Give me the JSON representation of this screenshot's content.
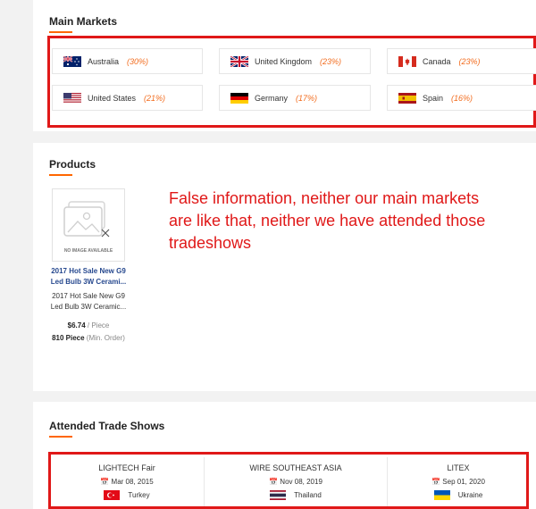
{
  "main_markets": {
    "title": "Main Markets",
    "items": [
      {
        "country": "Australia",
        "pct": "(30%)",
        "flag": "australia-flag"
      },
      {
        "country": "United Kingdom",
        "pct": "(23%)",
        "flag": "uk-flag"
      },
      {
        "country": "Canada",
        "pct": "(23%)",
        "flag": "canada-flag"
      },
      {
        "country": "United States",
        "pct": "(21%)",
        "flag": "usa-flag"
      },
      {
        "country": "Germany",
        "pct": "(17%)",
        "flag": "germany-flag"
      },
      {
        "country": "Spain",
        "pct": "(16%)",
        "flag": "spain-flag"
      }
    ]
  },
  "products": {
    "title": "Products",
    "item": {
      "image_placeholder": "NO IMAGE AVAILABLE",
      "title": "2017 Hot Sale New G9 Led Bulb 3W Cerami...",
      "subtitle": "2017 Hot Sale New G9 Led Bulb 3W Ceramic...",
      "price": "$6.74",
      "price_unit": "/ Piece",
      "moq": "810 Piece",
      "moq_label": "(Min. Order)"
    }
  },
  "annotation": "False information, neither our main markets are like that, neither we have attended those tradeshows",
  "trade_shows": {
    "title": "Attended Trade Shows",
    "items": [
      {
        "name": "LIGHTECH Fair",
        "date": "Mar 08, 2015",
        "country": "Turkey",
        "flag": "turkey-flag"
      },
      {
        "name": "WIRE SOUTHEAST ASIA",
        "date": "Nov 08, 2019",
        "country": "Thailand",
        "flag": "thailand-flag"
      },
      {
        "name": "LITEX",
        "date": "Sep 01, 2020",
        "country": "Ukraine",
        "flag": "ukraine-flag"
      }
    ]
  },
  "colors": {
    "accent": "#ff6600",
    "annotation_red": "#e01818",
    "link_blue": "#27498f"
  }
}
